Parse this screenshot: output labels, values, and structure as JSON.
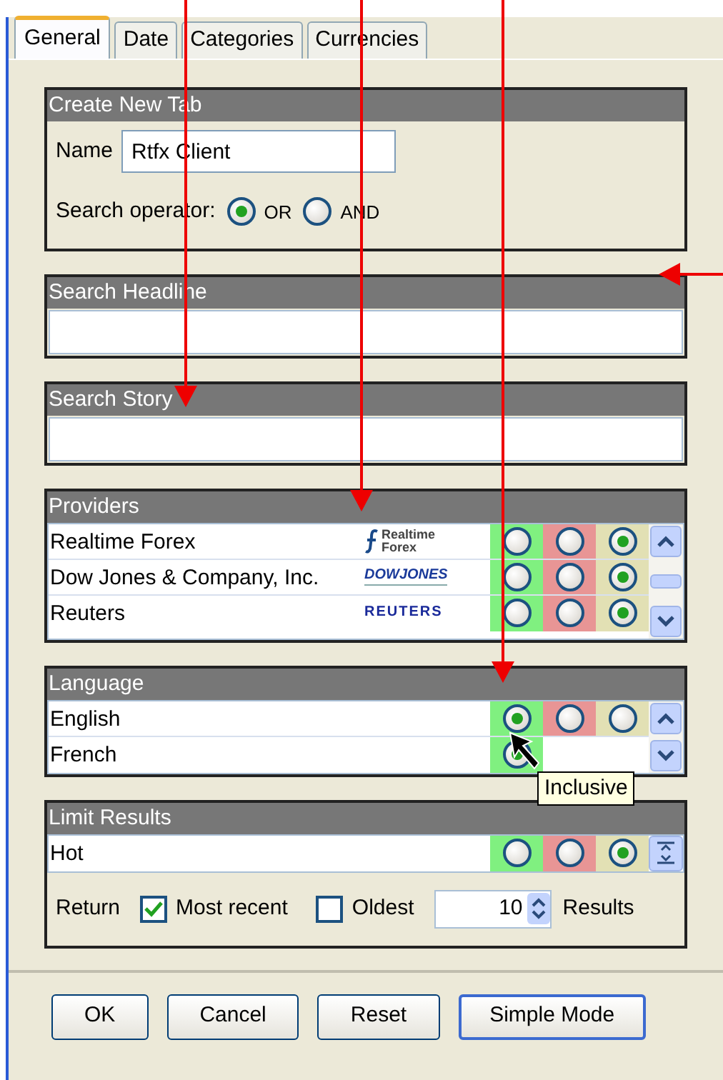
{
  "tabs": [
    {
      "label": "General",
      "selected": true
    },
    {
      "label": "Date",
      "selected": false
    },
    {
      "label": "Categories",
      "selected": false
    },
    {
      "label": "Currencies",
      "selected": false
    }
  ],
  "create_new_tab": {
    "title": "Create New Tab",
    "name_label": "Name",
    "name_value": "Rtfx Client",
    "operator_label": "Search operator:",
    "operators": [
      {
        "label": "OR",
        "selected": true
      },
      {
        "label": "AND",
        "selected": false
      }
    ]
  },
  "search_headline": {
    "title": "Search Headline"
  },
  "search_story": {
    "title": "Search Story"
  },
  "providers": {
    "title": "Providers",
    "rows": [
      {
        "name": "Realtime Forex",
        "logo": "Realtime Forex",
        "options": [
          {
            "selected": false,
            "color": "#80f080"
          },
          {
            "selected": false,
            "color": "#e89595"
          },
          {
            "selected": true,
            "color": "#e2e0b4"
          }
        ]
      },
      {
        "name": "Dow Jones & Company, Inc.",
        "logo": "DOWJONES",
        "options": [
          {
            "selected": false,
            "color": "#80f080"
          },
          {
            "selected": false,
            "color": "#e89595"
          },
          {
            "selected": true,
            "color": "#e2e0b4"
          }
        ]
      },
      {
        "name": "Reuters",
        "logo": "REUTERS",
        "options": [
          {
            "selected": false,
            "color": "#80f080"
          },
          {
            "selected": false,
            "color": "#e89595"
          },
          {
            "selected": true,
            "color": "#e2e0b4"
          }
        ]
      }
    ]
  },
  "language": {
    "title": "Language",
    "rows": [
      {
        "name": "English",
        "options": [
          {
            "selected": true,
            "color": "#80f080"
          },
          {
            "selected": false,
            "color": "#e89595"
          },
          {
            "selected": false,
            "color": "#e2e0b4"
          }
        ]
      },
      {
        "name": "French",
        "options": [
          {
            "selected": true,
            "color": "#80f080"
          }
        ]
      }
    ],
    "tooltip": "Inclusive"
  },
  "limit_results": {
    "title": "Limit Results",
    "rows": [
      {
        "name": "Hot",
        "options": [
          {
            "selected": false,
            "color": "#80f080"
          },
          {
            "selected": false,
            "color": "#e89595"
          },
          {
            "selected": true,
            "color": "#e2e0b4"
          }
        ]
      }
    ],
    "return_label": "Return",
    "checkboxes": [
      {
        "label": "Most recent",
        "checked": true
      },
      {
        "label": "Oldest",
        "checked": false
      }
    ],
    "count": "10",
    "results_label": "Results"
  },
  "buttons": [
    {
      "label": "OK",
      "default": false
    },
    {
      "label": "Cancel",
      "default": false
    },
    {
      "label": "Reset",
      "default": false
    },
    {
      "label": "Simple Mode",
      "default": true
    }
  ]
}
